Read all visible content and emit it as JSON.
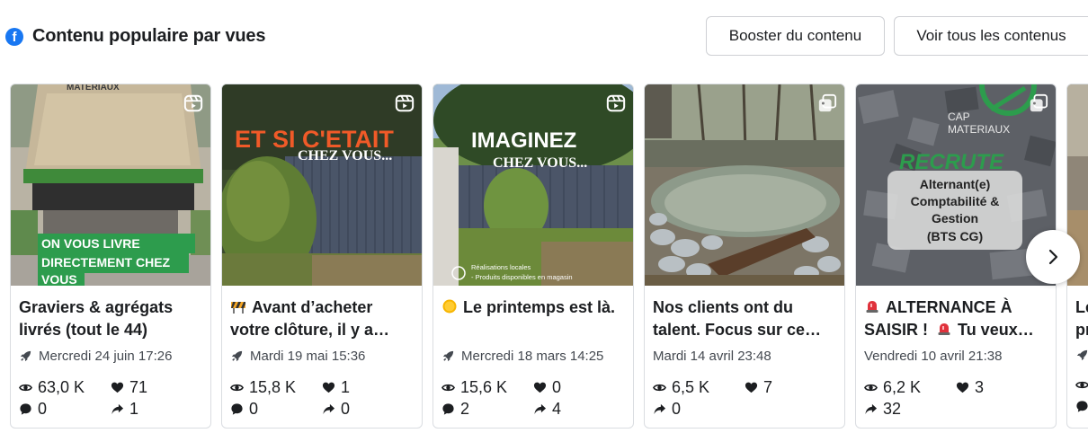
{
  "header": {
    "title": "Contenu populaire par vues",
    "boost_label": "Booster du contenu",
    "view_all_label": "Voir tous les contenus"
  },
  "cards": [
    {
      "image_text": [
        "MATERIAUX",
        "ON VOUS LIVRE",
        "DIRECTEMENT CHEZ",
        "VOUS"
      ],
      "caption_1": "Graviers & agrégats",
      "caption_2": "livrés (tout le 44)",
      "date": "Mercredi 24 juin 17:26",
      "views": "63,0 K",
      "likes": "71",
      "comments": "0",
      "shares": "1"
    },
    {
      "image_text": [
        "ET SI C'ETAIT",
        "CHEZ VOUS..."
      ],
      "caption_1": "Avant d’acheter",
      "caption_2": "votre clôture, il y a…",
      "date": "Mardi 19 mai 15:36",
      "views": "15,8 K",
      "likes": "1",
      "comments": "0",
      "shares": "0"
    },
    {
      "image_text": [
        "IMAGINEZ",
        "CHEZ VOUS...",
        "Réalisations locales",
        "- Produits disponibles en magasin"
      ],
      "caption_1": "Le printemps est là.",
      "caption_2": "",
      "date": "Mercredi 18 mars 14:25",
      "views": "15,6 K",
      "likes": "0",
      "comments": "2",
      "shares": "4"
    },
    {
      "caption_1": "Nos clients ont du",
      "caption_2": "talent. Focus sur ce…",
      "date": "Mardi 14 avril 23:48",
      "views": "6,5 K",
      "likes": "7",
      "shares": "0"
    },
    {
      "image_text": [
        "CAP",
        "MATERIAUX",
        "RECRUTE",
        "Alternant(e)",
        "Comptabilité &",
        "Gestion",
        "(BTS CG)"
      ],
      "caption_1": "ALTERNANCE À",
      "caption_2": "SAISIR !",
      "caption_2b": "Tu veux…",
      "date": "Vendredi 10 avril 21:38",
      "views": "6,2 K",
      "likes": "3",
      "shares": "32"
    },
    {
      "caption_1": "Le",
      "caption_2": "pr"
    }
  ]
}
